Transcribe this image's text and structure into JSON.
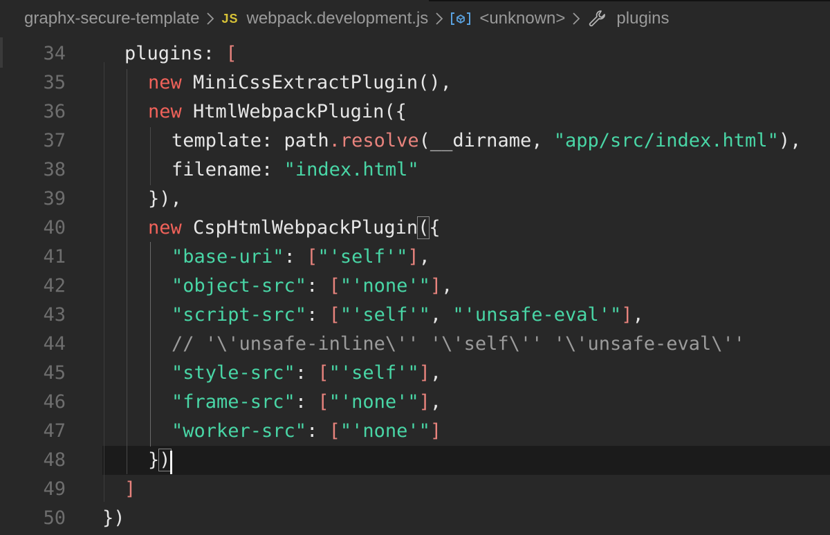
{
  "breadcrumb": {
    "folder": "graphx-secure-template",
    "js_badge": "JS",
    "file": "webpack.development.js",
    "symbol": "<unknown>",
    "property": "plugins"
  },
  "code": {
    "line_numbers": [
      "34",
      "35",
      "36",
      "37",
      "38",
      "39",
      "40",
      "41",
      "42",
      "43",
      "44",
      "45",
      "46",
      "47",
      "48",
      "49",
      "50"
    ],
    "l34": {
      "prop": "plugins",
      "colon": ": ",
      "bracket": "["
    },
    "l35": {
      "kw": "new",
      "rest": "MiniCssExtractPlugin(),"
    },
    "l36": {
      "kw": "new",
      "rest": "HtmlWebpackPlugin({"
    },
    "l37": {
      "prop": "template: path",
      "dot": ".",
      "method": "resolve",
      "open": "(",
      "arg": "__dirname, ",
      "str": "\"app/src/index.html\"",
      "close": "),"
    },
    "l38": {
      "prop": "filename: ",
      "str": "\"index.html\""
    },
    "l39": {
      "text": "}),"
    },
    "l40": {
      "kw": "new",
      "name": "CspHtmlWebpackPlugin",
      "paren": "(",
      "brace": "{"
    },
    "l41": {
      "key": "\"base-uri\"",
      "colon": ": ",
      "open": "[",
      "val": "\"'self'\"",
      "close": "]",
      "comma": ","
    },
    "l42": {
      "key": "\"object-src\"",
      "colon": ": ",
      "open": "[",
      "val": "\"'none'\"",
      "close": "]",
      "comma": ","
    },
    "l43": {
      "key": "\"script-src\"",
      "colon": ": ",
      "open": "[",
      "val": "\"'self'\"",
      "mid": ", ",
      "val2": "\"'unsafe-eval'\"",
      "close": "]",
      "comma": ","
    },
    "l44": {
      "comment": "// '\\'unsafe-inline\\'' '\\'self\\'' '\\'unsafe-eval\\''"
    },
    "l45": {
      "key": "\"style-src\"",
      "colon": ": ",
      "open": "[",
      "val": "\"'self'\"",
      "close": "]",
      "comma": ","
    },
    "l46": {
      "key": "\"frame-src\"",
      "colon": ": ",
      "open": "[",
      "val": "\"'none'\"",
      "close": "]",
      "comma": ","
    },
    "l47": {
      "key": "\"worker-src\"",
      "colon": ": ",
      "open": "[",
      "val": "\"'none'\"",
      "close": "]"
    },
    "l48": {
      "brace": "}",
      "paren": ")"
    },
    "l49": {
      "bracket": "]"
    },
    "l50": {
      "text": "})"
    }
  },
  "icons": {
    "chevron": "chevron-right-icon",
    "symbol": "symbol-variable-icon",
    "wrench": "wrench-icon"
  },
  "colors": {
    "background": "#282828",
    "keyword": "#f0625a",
    "string": "#49d6a6",
    "bracket": "#e8837d",
    "text": "#e6e6e6",
    "comment": "#9c9c9c",
    "line_number": "#6e6e6e",
    "js_badge": "#d7c237",
    "symbol_icon": "#5aa2e0"
  }
}
